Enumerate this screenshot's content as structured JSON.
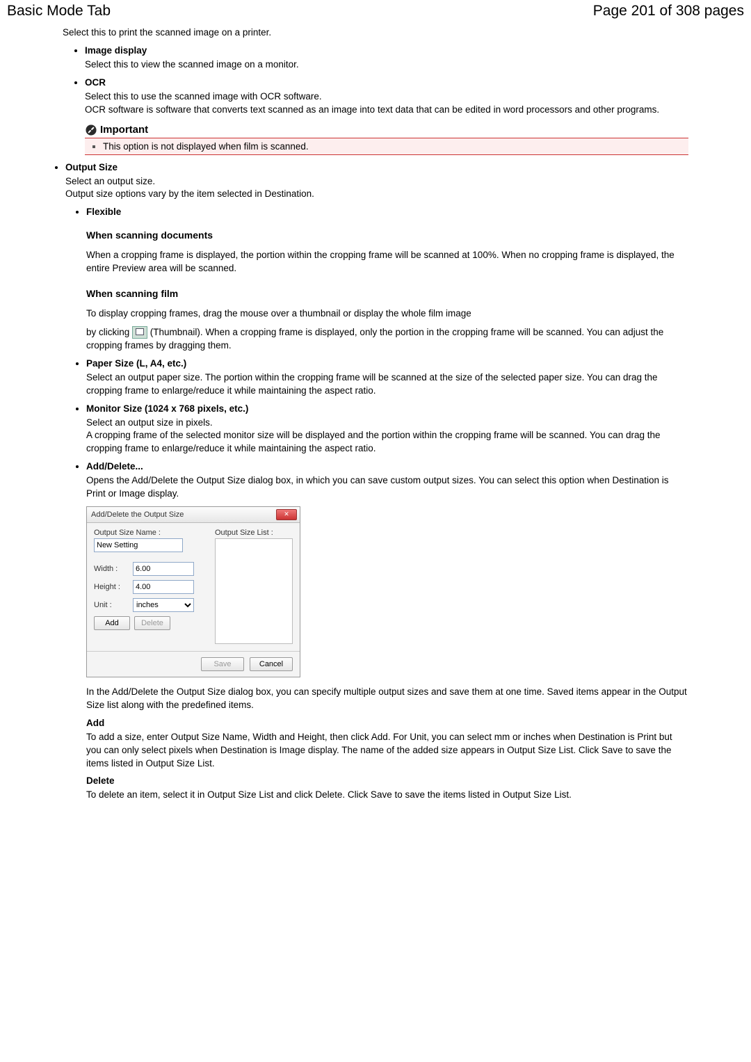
{
  "header": {
    "title": "Basic Mode Tab",
    "page_label": "Page 201 of 308 pages"
  },
  "body": {
    "print_desc": "Select this to print the scanned image on a printer.",
    "image_display_label": "Image display",
    "image_display_desc": "Select this to view the scanned image on a monitor.",
    "ocr_label": "OCR",
    "ocr_desc": "Select this to use the scanned image with OCR software.\nOCR software is software that converts text scanned as an image into text data that can be edited in word processors and other programs.",
    "important_title": "Important",
    "important_note": "This option is not displayed when film is scanned.",
    "output_size_label": "Output Size",
    "output_size_desc": "Select an output size.\nOutput size options vary by the item selected in Destination.",
    "flexible_label": "Flexible",
    "flex_docs_head": "When scanning documents",
    "flex_docs_body": "When a cropping frame is displayed, the portion within the cropping frame will be scanned at 100%. When no cropping frame is displayed, the entire Preview area will be scanned.",
    "flex_film_head": "When scanning film",
    "flex_film_body1": "To display cropping frames, drag the mouse over a thumbnail or display the whole film image",
    "flex_film_body2a": "by clicking ",
    "flex_film_body2b": " (Thumbnail). When a cropping frame is displayed, only the portion in the cropping frame will be scanned. You can adjust the cropping frames by dragging them.",
    "paper_size_label": "Paper Size (L, A4, etc.)",
    "paper_size_desc": "Select an output paper size. The portion within the cropping frame will be scanned at the size of the selected paper size. You can drag the cropping frame to enlarge/reduce it while maintaining the aspect ratio.",
    "monitor_size_label": "Monitor Size (1024 x 768 pixels, etc.)",
    "monitor_size_desc": "Select an output size in pixels.\nA cropping frame of the selected monitor size will be displayed and the portion within the cropping frame will be scanned. You can drag the cropping frame to enlarge/reduce it while maintaining the aspect ratio.",
    "adddel_label": "Add/Delete...",
    "adddel_desc": "Opens the Add/Delete the Output Size dialog box, in which you can save custom output sizes. You can select this option when Destination is Print or Image display.",
    "after_dialog": "In the Add/Delete the Output Size dialog box, you can specify multiple output sizes and save them at one time. Saved items appear in the Output Size list along with the predefined items.",
    "add_head": "Add",
    "add_body": "To add a size, enter Output Size Name, Width and Height, then click Add. For Unit, you can select mm or inches when Destination is Print but you can only select pixels when Destination is Image display. The name of the added size appears in Output Size List. Click Save to save the items listed in Output Size List.",
    "del_head": "Delete",
    "del_body": "To delete an item, select it in Output Size List and click Delete. Click Save to save the items listed in Output Size List."
  },
  "dialog": {
    "title": "Add/Delete the Output Size",
    "name_label": "Output Size Name :",
    "list_label": "Output Size List :",
    "name_value": "New Setting",
    "width_label": "Width :",
    "width_value": "6.00",
    "height_label": "Height :",
    "height_value": "4.00",
    "unit_label": "Unit :",
    "unit_value": "inches",
    "add_btn": "Add",
    "delete_btn": "Delete",
    "save_btn": "Save",
    "cancel_btn": "Cancel"
  }
}
